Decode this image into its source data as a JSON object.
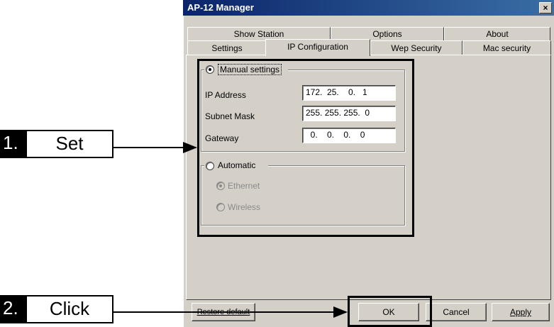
{
  "window": {
    "title": "AP-12 Manager",
    "close_glyph": "×"
  },
  "tabs": {
    "row1": [
      "Show Station",
      "Options",
      "About"
    ],
    "row2": [
      "Settings",
      "IP Configuration",
      "Wep Security",
      "Mac security"
    ],
    "active": "IP Configuration"
  },
  "manual": {
    "label": "Manual settings",
    "selected": true,
    "fields": [
      {
        "label": "IP Address",
        "value": "172.  25.    0.   1"
      },
      {
        "label": "Subnet Mask",
        "value": "255. 255. 255.  0"
      },
      {
        "label": "Gateway",
        "value": "  0.    0.    0.    0"
      }
    ]
  },
  "automatic": {
    "label": "Automatic",
    "selected": false,
    "options": [
      {
        "label": "Ethernet",
        "selected": true,
        "enabled": false
      },
      {
        "label": "Wireless",
        "selected": false,
        "enabled": false
      }
    ]
  },
  "buttons": {
    "restore": "Restore default",
    "ok": "OK",
    "cancel": "Cancel",
    "apply": "Apply"
  },
  "callouts": [
    {
      "number": "1.",
      "text": "Set"
    },
    {
      "number": "2.",
      "text": "Click"
    }
  ]
}
